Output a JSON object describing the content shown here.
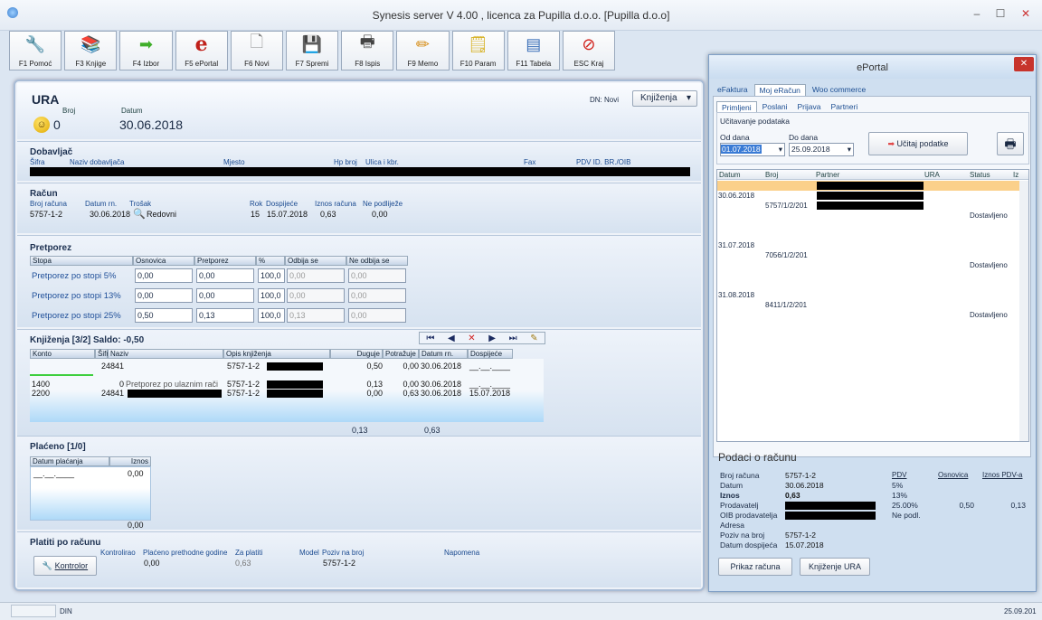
{
  "window": {
    "title": "Synesis server V 4.00 , licenca za Pupilla d.o.o. [Pupilla d.o.o]",
    "min": "–",
    "max": "☐",
    "close": "✕"
  },
  "toolbar": [
    {
      "label": "F1 Pomoć",
      "icon": "wrench-icon",
      "glyph": "🔧",
      "color": "#777"
    },
    {
      "label": "F3 Knjige",
      "icon": "books-icon",
      "glyph": "📚",
      "color": "#c58a1a"
    },
    {
      "label": "F4 Izbor",
      "icon": "arrow-right-icon",
      "glyph": "➡",
      "color": "#3fae2a"
    },
    {
      "label": "F5 ePortal",
      "icon": "eportal-icon",
      "glyph": "e",
      "color": "#c0201a"
    },
    {
      "label": "F6 Novi",
      "icon": "new-document-icon",
      "glyph": "🗋",
      "color": "#888"
    },
    {
      "label": "F7 Spremi",
      "icon": "save-icon",
      "glyph": "💾",
      "color": "#2a4f8a"
    },
    {
      "label": "F8 Ispis",
      "icon": "printer-icon",
      "glyph": "🖶",
      "color": "#444"
    },
    {
      "label": "F9 Memo",
      "icon": "pencil-icon",
      "glyph": "✏",
      "color": "#d58a10"
    },
    {
      "label": "F10 Param",
      "icon": "notepad-icon",
      "glyph": "🗒",
      "color": "#d6b020"
    },
    {
      "label": "F11 Tabela",
      "icon": "table-icon",
      "glyph": "▤",
      "color": "#3a6fb8"
    },
    {
      "label": "ESC Kraj",
      "icon": "stop-icon",
      "glyph": "⊘",
      "color": "#d0201a"
    }
  ],
  "doc": {
    "title": "URA",
    "broj_label": "Broj",
    "broj": "0",
    "datum_label": "Datum",
    "datum": "30.06.2018",
    "dn_label": "DN: Novi",
    "knjizenja_btn": "Knjiženja"
  },
  "dobavljac": {
    "title": "Dobavljač",
    "headers": [
      "Šifra",
      "Naziv dobavljača",
      "Mjesto",
      "Hp broj",
      "Ulica i kbr.",
      "Fax",
      "PDV ID. BR./OIB"
    ]
  },
  "racun": {
    "title": "Račun",
    "labels": [
      "Broj računa",
      "Datum rn.",
      "Trošak",
      "Rok",
      "Dospijeće",
      "Iznos računa",
      "Ne podliježe"
    ],
    "broj": "5757-1-2",
    "datum": "30.06.2018",
    "trosak": "Redovni",
    "rok": "15",
    "dospijece": "15.07.2018",
    "iznos": "0,63",
    "ne_podlijeze": "0,00"
  },
  "pretporez": {
    "title": "Pretporez",
    "headers": [
      "Stopa",
      "Osnovica",
      "Pretporez",
      "%",
      "Odbija se",
      "Ne odbija se"
    ],
    "rows": [
      {
        "stopa": "Pretporez po stopi 5%",
        "osnovica": "0,00",
        "pretporez": "0,00",
        "pct": "100,0",
        "odbija": "0,00",
        "ne_odbija": "0,00"
      },
      {
        "stopa": "Pretporez po stopi 13%",
        "osnovica": "0,00",
        "pretporez": "0,00",
        "pct": "100,0",
        "odbija": "0,00",
        "ne_odbija": "0,00"
      },
      {
        "stopa": "Pretporez po stopi 25%",
        "osnovica": "0,50",
        "pretporez": "0,13",
        "pct": "100,0",
        "odbija": "0,13",
        "ne_odbija": "0,00"
      }
    ]
  },
  "knjizenja": {
    "title": "Knjiženja  [3/2]  Saldo: -0,50",
    "headers": [
      "Konto",
      "Šifra",
      "Naziv",
      "Opis knjiženja",
      "Duguje",
      "Potražuje",
      "Datum rn.",
      "Dospijeće"
    ],
    "rows": [
      {
        "konto": "",
        "sifra": "24841",
        "naziv": "",
        "opis": "5757-1-2",
        "duguje": "0,50",
        "potrazuje": "0,00",
        "datum": "30.06.2018",
        "dospijece": "__.__.____"
      },
      {
        "konto": "1400",
        "sifra": "0",
        "naziv": "Pretporez po ulaznim rači",
        "opis": "5757-1-2",
        "duguje": "0,13",
        "potrazuje": "0,00",
        "datum": "30.06.2018",
        "dospijece": "__.__.____"
      },
      {
        "konto": "2200",
        "sifra": "24841",
        "naziv": "",
        "opis": "5757-1-2",
        "duguje": "0,00",
        "potrazuje": "0,63",
        "datum": "30.06.2018",
        "dospijece": "15.07.2018"
      }
    ],
    "sum_duguje": "0,13",
    "sum_potrazuje": "0,63"
  },
  "placeno": {
    "title": "Plaćeno  [1/0]",
    "headers": [
      "Datum plaćanja",
      "Iznos"
    ],
    "row": {
      "datum": "__.__.____",
      "iznos": "0,00"
    },
    "sum": "0,00"
  },
  "platiti": {
    "title": "Platiti po računu",
    "labels": [
      "Kontrolirao",
      "Plaćeno prethodne godine",
      "Za platiti",
      "Model",
      "Poziv na broj",
      "Napomena"
    ],
    "placeno_prethodne": "0,00",
    "za_platiti": "0,63",
    "poziv": "5757-1-2",
    "kontrolor_btn": "Kontrolor"
  },
  "eportal": {
    "title": "ePortal",
    "tabs": [
      "eFaktura",
      "Moj eRačun",
      "Woo commerce"
    ],
    "subtabs": [
      "Primljeni",
      "Poslani",
      "Prijava",
      "Partneri"
    ],
    "load_group": "Učitavanje podataka",
    "od_label": "Od dana",
    "od": "01.07.2018",
    "do_label": "Do dana",
    "do": "25.09.2018",
    "ucitaj_btn": "Učitaj podatke",
    "headers": [
      "Datum",
      "Broj",
      "Partner",
      "URA",
      "Status",
      "Iz"
    ],
    "rows": [
      {
        "datum": "30.06.2018",
        "broj": "5757/1/2/201",
        "status": "Dostavljeno"
      },
      {
        "datum": "31.07.2018",
        "broj": "7056/1/2/201",
        "status": "Dostavljeno"
      },
      {
        "datum": "31.08.2018",
        "broj": "8411/1/2/201",
        "status": "Dostavljeno"
      }
    ],
    "podaci_title": "Podaci o računu",
    "p_labels": [
      "Broj računa",
      "Datum",
      "Iznos",
      "Prodavatelj",
      "OIB prodavatelja",
      "Adresa",
      "Poziv na broj",
      "Datum dospijeća"
    ],
    "p_broj": "5757-1-2",
    "p_datum": "30.06.2018",
    "p_iznos": "0,63",
    "p_poziv": "5757-1-2",
    "p_dospijece": "15.07.2018",
    "pdv_headers": [
      "PDV",
      "Osnovica",
      "Iznos PDV-a"
    ],
    "pdv_rows": [
      {
        "pdv": "5%",
        "osn": "",
        "izn": ""
      },
      {
        "pdv": "13%",
        "osn": "",
        "izn": ""
      },
      {
        "pdv": "25.00%",
        "osn": "0,50",
        "izn": "0,13"
      },
      {
        "pdv": "Ne podl.",
        "osn": "",
        "izn": ""
      }
    ],
    "prikaz_btn": "Prikaz računa",
    "knjizenje_btn": "Knjiženje URA"
  },
  "status": {
    "left": "DIN",
    "right": "25.09.201"
  }
}
